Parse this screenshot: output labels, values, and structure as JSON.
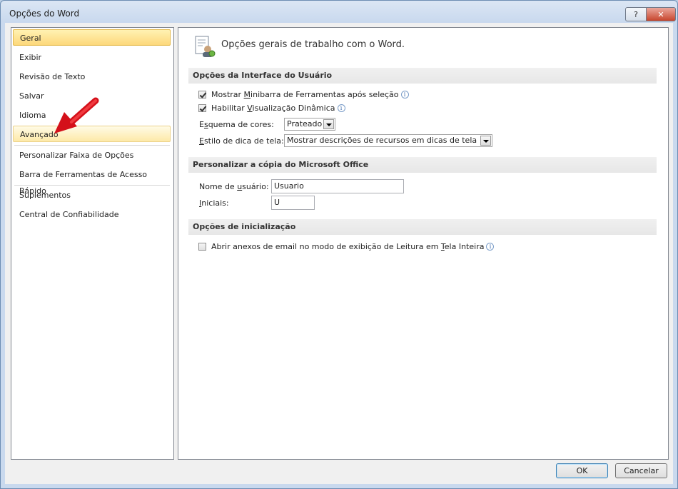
{
  "window": {
    "title": "Opções do Word",
    "help_label": "?",
    "close_label": "✕"
  },
  "sidebar": {
    "items": [
      {
        "label": "Geral"
      },
      {
        "label": "Exibir"
      },
      {
        "label": "Revisão de Texto"
      },
      {
        "label": "Salvar"
      },
      {
        "label": "Idioma"
      },
      {
        "label": "Avançado"
      },
      {
        "label": "Personalizar Faixa de Opções"
      },
      {
        "label": "Barra de Ferramentas de Acesso Rápido"
      },
      {
        "label": "Suplementos"
      },
      {
        "label": "Central de Confiabilidade"
      }
    ]
  },
  "main": {
    "header_title": "Opções gerais de trabalho com o Word.",
    "sections": {
      "ui": {
        "title": "Opções da Interface do Usuário",
        "minibar_pre": "Mostrar ",
        "minibar_u": "M",
        "minibar_post": "inibarra de Ferramentas após seleção",
        "live_pre": "Habilitar ",
        "live_u": "V",
        "live_post": "isualização Dinâmica",
        "color_label_pre": "E",
        "color_label_u": "s",
        "color_label_post": "quema de cores:",
        "color_value": "Prateado",
        "tip_label_u": "E",
        "tip_label_post": "stilo de dica de tela:",
        "tip_value": "Mostrar descrições de recursos em dicas de tela"
      },
      "office": {
        "title": "Personalizar a cópia do Microsoft Office",
        "username_label_pre": "Nome de ",
        "username_label_u": "u",
        "username_label_post": "suário:",
        "username_value": "Usuario",
        "initials_label_u": "I",
        "initials_label_post": "niciais:",
        "initials_value": "U"
      },
      "startup": {
        "title": "Opções de inicialização",
        "attach_pre": "Abrir anexos de email no modo de exibição de Leitura em ",
        "attach_u": "T",
        "attach_post": "ela Inteira"
      }
    }
  },
  "footer": {
    "ok_label": "OK",
    "cancel_label": "Cancelar"
  },
  "info_glyph": "i",
  "checkboxes": {
    "minibar": true,
    "live_preview": true,
    "reading_mode": false
  },
  "colors": {
    "selected_nav": "#fdd87b",
    "arrow": "#e8141a"
  }
}
